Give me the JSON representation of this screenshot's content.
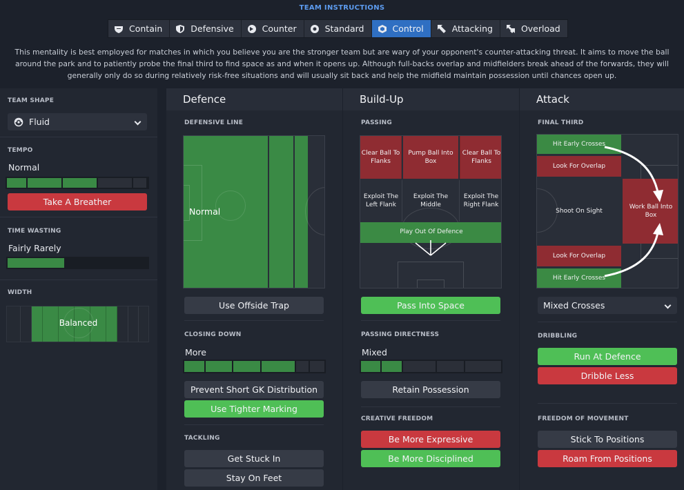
{
  "header": {
    "title": "TEAM INSTRUCTIONS"
  },
  "tabs": [
    {
      "label": "Contain",
      "icon": "contain-icon"
    },
    {
      "label": "Defensive",
      "icon": "shield-icon"
    },
    {
      "label": "Counter",
      "icon": "counter-icon"
    },
    {
      "label": "Standard",
      "icon": "standard-icon"
    },
    {
      "label": "Control",
      "icon": "control-icon",
      "active": true
    },
    {
      "label": "Attacking",
      "icon": "attacking-icon"
    },
    {
      "label": "Overload",
      "icon": "overload-icon"
    }
  ],
  "description": "This mentality is best employed for matches in which you believe you are the stronger team but are wary of your opponent's counter-attacking threat. It aims to move the ball around the park and to patiently probe the final third to find space as and when it opens up. Although full-backs overlap and midfielders break ahead of the forwards, they will generally only do so during relatively risk-free situations and will usually sit back and help the midfield maintain possession until chances open up.",
  "left": {
    "team_shape": {
      "label": "TEAM SHAPE",
      "value": "Fluid"
    },
    "tempo": {
      "label": "TEMPO",
      "value": "Normal",
      "level": 0.6,
      "button": "Take A Breather"
    },
    "time_wasting": {
      "label": "TIME WASTING",
      "value": "Fairly Rarely",
      "level": 0.4
    },
    "width": {
      "label": "WIDTH",
      "value": "Balanced"
    }
  },
  "defence": {
    "title": "Defence",
    "defensive_line": {
      "label": "DEFENSIVE LINE",
      "value": "Normal"
    },
    "offside_button": "Use Offside Trap",
    "closing_down": {
      "label": "CLOSING DOWN",
      "value": "More",
      "level": 0.8
    },
    "buttons": [
      "Prevent Short GK Distribution",
      "Use Tighter Marking"
    ],
    "tackling": {
      "label": "TACKLING",
      "buttons": [
        "Get Stuck In",
        "Stay On Feet"
      ]
    }
  },
  "buildup": {
    "title": "Build-Up",
    "passing_label": "PASSING",
    "zones": {
      "clear_left": "Clear Ball To Flanks",
      "pump": "Pump Ball Into Box",
      "clear_right": "Clear Ball To Flanks",
      "exploit_left": "Exploit The Left Flank",
      "exploit_middle": "Exploit The Middle",
      "exploit_right": "Exploit The Right Flank",
      "play_out": "Play Out Of Defence"
    },
    "pass_space": "Pass Into Space",
    "directness": {
      "label": "PASSING DIRECTNESS",
      "value": "Mixed",
      "level": 0.3
    },
    "retain": "Retain Possession",
    "creative": {
      "label": "CREATIVE FREEDOM",
      "buttons": [
        "Be More Expressive",
        "Be More Disciplined"
      ]
    }
  },
  "attack": {
    "title": "Attack",
    "final_third_label": "FINAL THIRD",
    "zones": {
      "hit_top": "Hit Early Crosses",
      "overlap_top": "Look For Overlap",
      "shoot": "Shoot On Sight",
      "work": "Work Ball Into Box",
      "overlap_bottom": "Look For Overlap",
      "hit_bottom": "Hit Early Crosses"
    },
    "crosses": "Mixed Crosses",
    "dribbling": {
      "label": "DRIBBLING",
      "buttons": [
        "Run At Defence",
        "Dribble Less"
      ]
    },
    "freedom": {
      "label": "FREEDOM OF MOVEMENT",
      "buttons": [
        "Stick To Positions",
        "Roam From Positions"
      ]
    }
  }
}
